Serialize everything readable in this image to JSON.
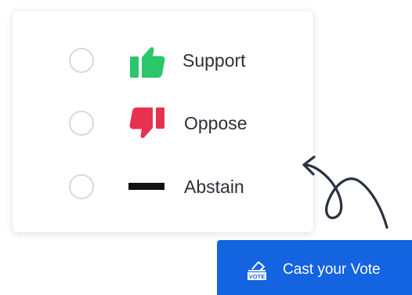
{
  "options": [
    {
      "label": "Support",
      "icon": "thumbs-up-icon",
      "icon_color": "#2bc76b"
    },
    {
      "label": "Oppose",
      "icon": "thumbs-down-icon",
      "icon_color": "#e8314f"
    },
    {
      "label": "Abstain",
      "icon": "dash-icon",
      "icon_color": "#111111"
    }
  ],
  "cast_button": {
    "label": "Cast your Vote",
    "icon": "ballot-box-icon",
    "icon_text": "VOTE",
    "background": "#1463e0"
  },
  "colors": {
    "radio_border": "#d5dae1",
    "label_text": "#2c3038",
    "arrow": "#2a3140"
  }
}
